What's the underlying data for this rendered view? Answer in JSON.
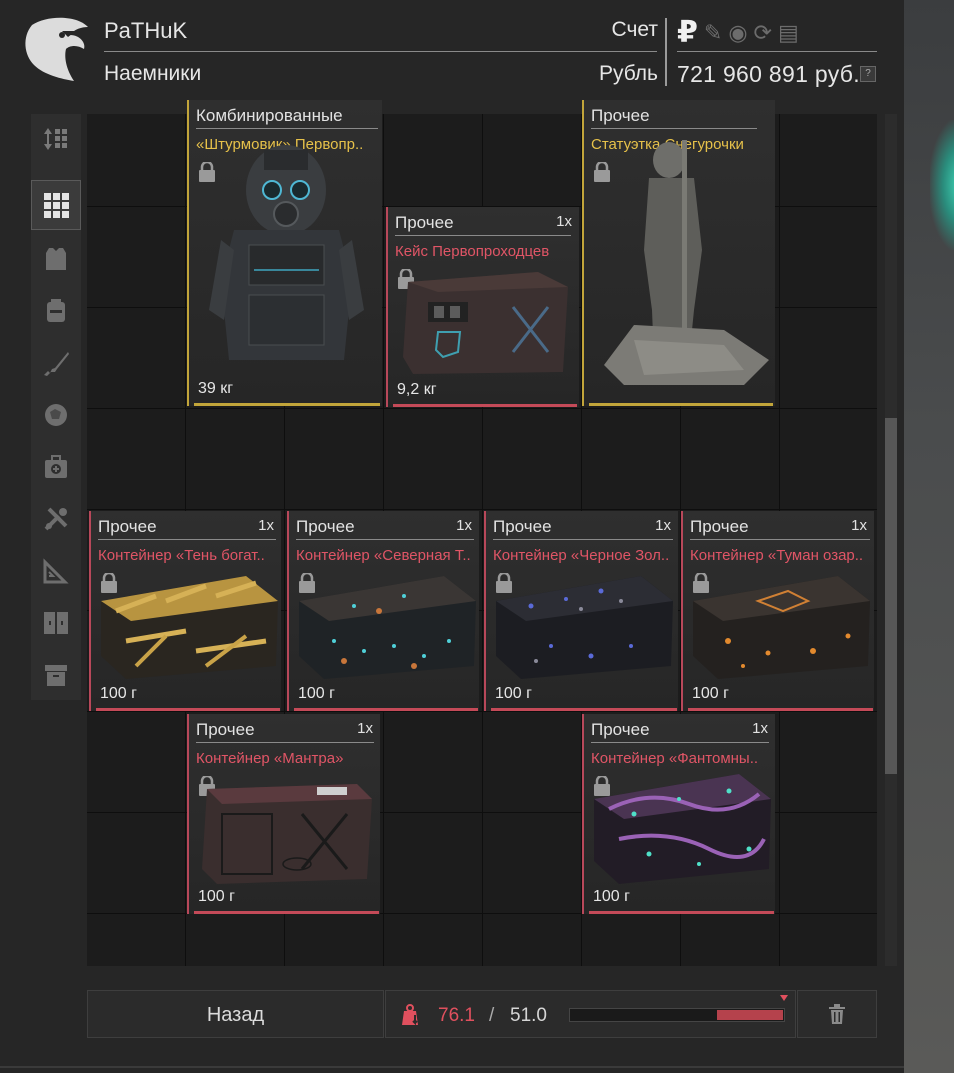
{
  "header": {
    "player_name": "PaTHuK",
    "faction": "Наемники",
    "account_label": "Счет",
    "currency_label": "Рубль",
    "balance": "721 960 891 руб.",
    "help_badge": "?",
    "currency_icons": [
      "ruble-icon",
      "gp-icon",
      "coin-icon",
      "token-icon",
      "card-icon"
    ]
  },
  "sidebar": {
    "items": [
      {
        "name": "sort-icon"
      },
      {
        "name": "all-items-icon"
      },
      {
        "name": "armor-icon"
      },
      {
        "name": "backpack-icon"
      },
      {
        "name": "weapon-icon"
      },
      {
        "name": "artifact-icon"
      },
      {
        "name": "medkit-icon"
      },
      {
        "name": "tools-icon"
      },
      {
        "name": "ruler-icon"
      },
      {
        "name": "container-icon"
      },
      {
        "name": "box-icon"
      }
    ]
  },
  "items": [
    {
      "category": "Комбинированные",
      "quantity": "",
      "name": "«Штурмовик» Первопр..",
      "weight": "39 кг",
      "rarity": "gold",
      "image": "armor-suit"
    },
    {
      "category": "Прочее",
      "quantity": "1x",
      "name": "Кейс Первопроходцев",
      "weight": "9,2 кг",
      "rarity": "red",
      "image": "case"
    },
    {
      "category": "Прочее",
      "quantity": "",
      "name": "Статуэтка Снегурочки",
      "weight": "",
      "rarity": "gold",
      "image": "statue"
    },
    {
      "category": "Прочее",
      "quantity": "1x",
      "name": "Контейнер «Тень богат..",
      "weight": "100 г",
      "rarity": "red",
      "image": "container-gold"
    },
    {
      "category": "Прочее",
      "quantity": "1x",
      "name": "Контейнер «Северная Т..",
      "weight": "100 г",
      "rarity": "red",
      "image": "container-cyan"
    },
    {
      "category": "Прочее",
      "quantity": "1x",
      "name": "Контейнер «Черное Зол..",
      "weight": "100 г",
      "rarity": "red",
      "image": "container-blue"
    },
    {
      "category": "Прочее",
      "quantity": "1x",
      "name": "Контейнер «Туман озар..",
      "weight": "100 г",
      "rarity": "red",
      "image": "container-orange"
    },
    {
      "category": "Прочее",
      "quantity": "1x",
      "name": "Контейнер «Мантра»",
      "weight": "100 г",
      "rarity": "red",
      "image": "container-mantra"
    },
    {
      "category": "Прочее",
      "quantity": "1x",
      "name": "Контейнер «Фантомны..",
      "weight": "100 г",
      "rarity": "red",
      "image": "container-purple"
    }
  ],
  "footer": {
    "back_label": "Назад",
    "weight_current": "76.1",
    "weight_separator": "/",
    "weight_max": "51.0",
    "weight_fill_fraction": 0.3
  },
  "colors": {
    "rarity_red": "#e05566",
    "rarity_gold": "#e6c14a",
    "overweight": "#e0505e"
  }
}
